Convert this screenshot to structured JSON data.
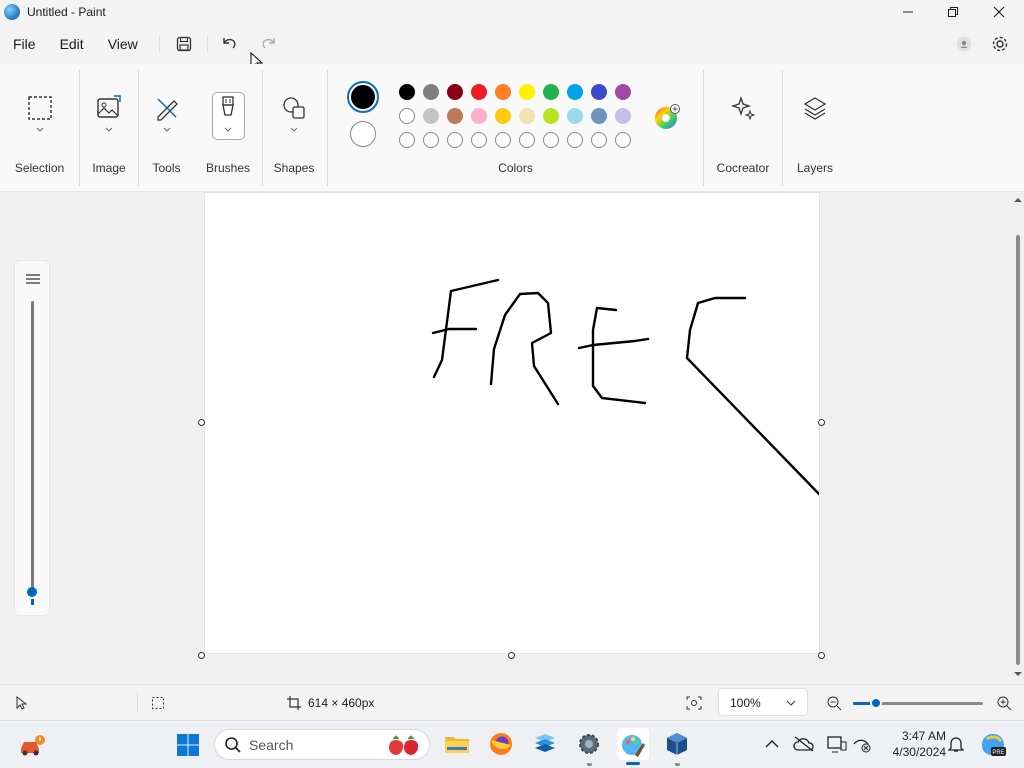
{
  "window": {
    "title": "Untitled - Paint"
  },
  "menu": {
    "file": "File",
    "edit": "Edit",
    "view": "View"
  },
  "ribbon": {
    "selection": "Selection",
    "image": "Image",
    "tools": "Tools",
    "brushes": "Brushes",
    "shapes": "Shapes",
    "colors": "Colors",
    "cocreator": "Cocreator",
    "layers": "Layers",
    "primary_color": "#000000",
    "secondary_color": "#ffffff",
    "palette_row1": [
      "#000000",
      "#7f7f7f",
      "#880015",
      "#ed1c24",
      "#ff7f27",
      "#fff200",
      "#22b14c",
      "#00a2e8",
      "#3f48cc",
      "#a349a4"
    ],
    "palette_row2": [
      "#ffffff",
      "#c3c3c3",
      "#b97a57",
      "#ffaec9",
      "#ffc90e",
      "#efe4b0",
      "#b5e61d",
      "#99d9ea",
      "#7092be",
      "#c8bfe7"
    ]
  },
  "canvas": {
    "drawing_text": "FREC"
  },
  "status": {
    "canvas_size": "614 × 460px",
    "zoom": "100%"
  },
  "taskbar": {
    "search_placeholder": "Search",
    "time": "3:47 AM",
    "date": "4/30/2024"
  }
}
